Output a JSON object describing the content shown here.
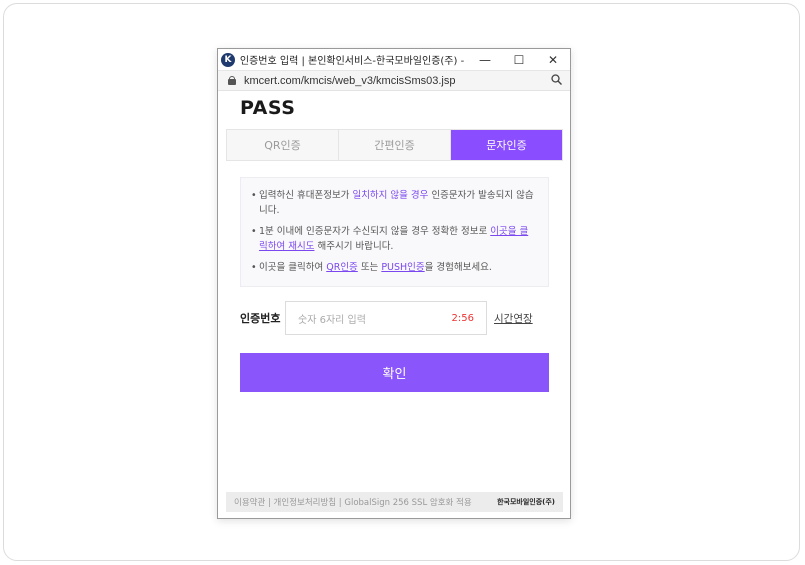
{
  "window": {
    "app_icon": "K",
    "title": "인증번호 입력 | 본인확인서비스-한국모바일인증(주) - G...",
    "controls": {
      "minimize": "—",
      "maximize": "☐",
      "close": "✕"
    }
  },
  "address": {
    "url": "kmcert.com/kmcis/web_v3/kmcisSms03.jsp",
    "zoom_icon": "🔍"
  },
  "brand": {
    "logo": "PASS"
  },
  "tabs": [
    {
      "label": "QR인증",
      "active": false
    },
    {
      "label": "간편인증",
      "active": false
    },
    {
      "label": "문자인증",
      "active": true
    }
  ],
  "notice": {
    "line1_pre": "입력하신 휴대폰정보가 ",
    "line1_hl": "일치하지 않을 경우",
    "line1_post": " 인증문자가 발송되지 않습니다.",
    "line2_pre": "1분 이내에 인증문자가 수신되지 않을 경우 정확한 정보로 ",
    "line2_link": "이곳을 클릭하여 재시도",
    "line2_post": " 해주시기 바랍니다.",
    "line3_pre": "이곳을 클릭하여 ",
    "line3_link1": "QR인증",
    "line3_mid": " 또는 ",
    "line3_link2": "PUSH인증",
    "line3_post": "을 경험해보세요."
  },
  "auth": {
    "label": "인증번호",
    "placeholder": "숫자 6자리 입력",
    "timer": "2:56",
    "extend": "시간연장"
  },
  "confirm_label": "확인",
  "footer": {
    "links": "이용약관 | 개인정보처리방침 | GlobalSign 256 SSL 암호화 적용",
    "brand": "한국모바일인증(주)"
  },
  "colors": {
    "accent": "#8a4dff",
    "timer": "#ee3333"
  }
}
